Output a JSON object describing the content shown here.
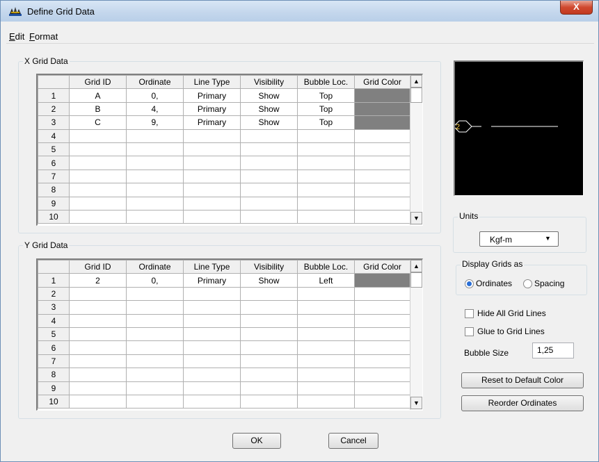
{
  "window": {
    "title": "Define Grid Data",
    "close_glyph": "X"
  },
  "menu": [
    {
      "label": "Edit",
      "accel": "E",
      "rest": "dit"
    },
    {
      "label": "Format",
      "accel": "F",
      "rest": "ormat"
    }
  ],
  "x_grid": {
    "title": "X Grid Data",
    "columns": [
      "Grid ID",
      "Ordinate",
      "Line Type",
      "Visibility",
      "Bubble Loc.",
      "Grid Color"
    ],
    "rows": [
      {
        "num": "1",
        "id": "A",
        "ordinate": "0,",
        "line_type": "Primary",
        "visibility": "Show",
        "bubble": "Top",
        "color": true
      },
      {
        "num": "2",
        "id": "B",
        "ordinate": "4,",
        "line_type": "Primary",
        "visibility": "Show",
        "bubble": "Top",
        "color": true
      },
      {
        "num": "3",
        "id": "C",
        "ordinate": "9,",
        "line_type": "Primary",
        "visibility": "Show",
        "bubble": "Top",
        "color": true
      },
      {
        "num": "4"
      },
      {
        "num": "5"
      },
      {
        "num": "6"
      },
      {
        "num": "7"
      },
      {
        "num": "8"
      },
      {
        "num": "9"
      },
      {
        "num": "10"
      }
    ]
  },
  "y_grid": {
    "title": "Y Grid Data",
    "columns": [
      "Grid ID",
      "Ordinate",
      "Line Type",
      "Visibility",
      "Bubble Loc.",
      "Grid Color"
    ],
    "rows": [
      {
        "num": "1",
        "id": "2",
        "ordinate": "0,",
        "line_type": "Primary",
        "visibility": "Show",
        "bubble": "Left",
        "color": true
      },
      {
        "num": "2"
      },
      {
        "num": "3"
      },
      {
        "num": "4"
      },
      {
        "num": "5"
      },
      {
        "num": "6"
      },
      {
        "num": "7"
      },
      {
        "num": "8"
      },
      {
        "num": "9"
      },
      {
        "num": "10"
      }
    ]
  },
  "preview": {
    "bubble_label": "2"
  },
  "units": {
    "title": "Units",
    "value": "Kgf-m"
  },
  "display_grids": {
    "title": "Display Grids as",
    "options": [
      {
        "label": "Ordinates",
        "checked": true
      },
      {
        "label": "Spacing",
        "checked": false
      }
    ]
  },
  "options": {
    "hide_all_grid_lines": "Hide All Grid Lines",
    "glue_to_grid_lines": "Glue to Grid Lines",
    "bubble_size_label": "Bubble Size",
    "bubble_size_value": "1,25"
  },
  "buttons": {
    "reset_color": "Reset to Default Color",
    "reorder": "Reorder Ordinates",
    "ok": "OK",
    "cancel": "Cancel"
  },
  "colors": {
    "grid_color_cell": "#808080",
    "preview_bg": "#000000",
    "preview_line": "#ffffff",
    "preview_bubble": "#ffd24a"
  }
}
